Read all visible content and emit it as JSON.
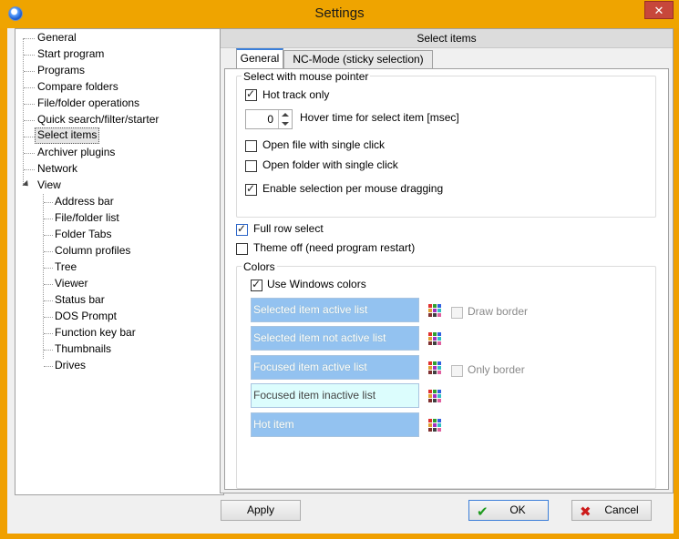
{
  "window": {
    "title": "Settings",
    "close_label": "✕"
  },
  "tree": {
    "items": [
      {
        "label": "General"
      },
      {
        "label": "Start program"
      },
      {
        "label": "Programs"
      },
      {
        "label": "Compare folders"
      },
      {
        "label": "File/folder operations"
      },
      {
        "label": "Quick search/filter/starter"
      },
      {
        "label": "Select items",
        "selected": true
      },
      {
        "label": "Archiver plugins"
      },
      {
        "label": "Network"
      },
      {
        "label": "View",
        "expanded": true
      }
    ],
    "view_children": [
      {
        "label": "Address bar"
      },
      {
        "label": "File/folder list"
      },
      {
        "label": "Folder Tabs"
      },
      {
        "label": "Column profiles"
      },
      {
        "label": "Tree"
      },
      {
        "label": "Viewer"
      },
      {
        "label": "Status bar"
      },
      {
        "label": "DOS Prompt"
      },
      {
        "label": "Function key bar"
      },
      {
        "label": "Thumbnails"
      },
      {
        "label": "Drives"
      }
    ]
  },
  "panel": {
    "header": "Select items",
    "tabs": [
      {
        "label": "General",
        "active": true
      },
      {
        "label": "NC-Mode (sticky selection)"
      }
    ],
    "mouse_group": {
      "title": "Select with mouse pointer",
      "hot_track": {
        "label": "Hot track only",
        "checked": true
      },
      "hover": {
        "label": "Hover time for select item [msec]",
        "value": "0"
      },
      "open_file": {
        "label": "Open file with single click",
        "checked": false
      },
      "open_folder": {
        "label": "Open folder with single click",
        "checked": false
      },
      "drag_select": {
        "label": "Enable selection per mouse dragging",
        "checked": true
      }
    },
    "full_row": {
      "label": "Full row select",
      "checked": true
    },
    "theme_off": {
      "label": "Theme off (need program restart)",
      "checked": false
    },
    "colors_group": {
      "title": "Colors",
      "use_windows": {
        "label": "Use Windows colors",
        "checked": true
      },
      "items": [
        {
          "label": "Selected item active list",
          "bg": "#93c2f0"
        },
        {
          "label": "Selected item not active list",
          "bg": "#93c2f0"
        },
        {
          "label": "Focused item active list",
          "bg": "#93c2f0"
        },
        {
          "label": "Focused item inactive list",
          "bg": "#dcfdfd"
        },
        {
          "label": "Hot item",
          "bg": "#93c2f0"
        }
      ],
      "draw_border": {
        "label": "Draw border",
        "checked": false
      },
      "only_border": {
        "label": "Only border",
        "checked": false
      }
    }
  },
  "buttons": {
    "apply": "Apply",
    "ok": "OK",
    "cancel": "Cancel"
  },
  "colors": {
    "title_bar": "#efa400",
    "accent": "#3c7fd9",
    "ok_icon": "#1e9a1e",
    "cancel_icon": "#cc1a1a"
  }
}
